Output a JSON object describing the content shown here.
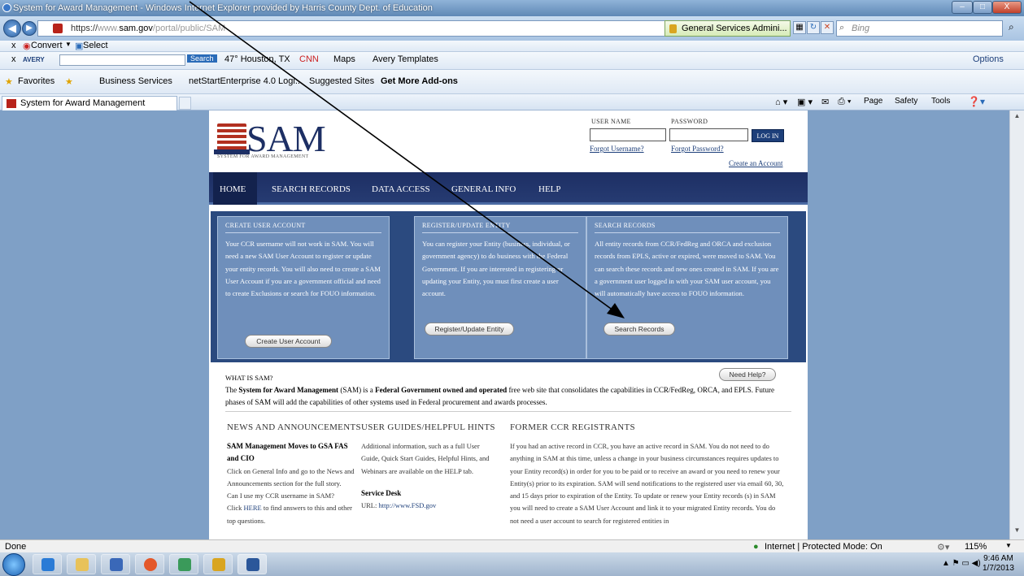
{
  "window": {
    "title": "System for Award Management - Windows Internet Explorer provided by Harris County Dept. of Education",
    "minimize": "–",
    "maximize": "□",
    "close": "X"
  },
  "addressbar": {
    "scheme": "https://",
    "host_prefix": "www.",
    "host": "sam.gov",
    "path": "/portal/public/SAM",
    "site_identity": "General Services Admini...",
    "search_placeholder": "Bing"
  },
  "toolbar1": {
    "convert": "Convert",
    "select": "Select"
  },
  "toolbar2": {
    "avery": "AVERY",
    "search": "Search",
    "weather": "47° Houston, TX",
    "cnn": "CNN",
    "maps": "Maps",
    "templates": "Avery Templates",
    "options": "Options"
  },
  "favorites": {
    "label": "Favorites",
    "items": [
      "Business Services",
      "netStartEnterprise 4.0 Logi...",
      "Suggested Sites",
      "Get More Add-ons"
    ]
  },
  "tab": {
    "label": "System for Award Management"
  },
  "commandbar": {
    "page": "Page",
    "safety": "Safety",
    "tools": "Tools"
  },
  "header": {
    "logo_text": "SAM",
    "logo_sub": "SYSTEM FOR AWARD MANAGEMENT",
    "username_label": "USER NAME",
    "password_label": "PASSWORD",
    "login": "LOG IN",
    "forgot_username": "Forgot Username?",
    "forgot_password": "Forgot Password?",
    "create_account": "Create an Account"
  },
  "nav": [
    "HOME",
    "SEARCH RECORDS",
    "DATA ACCESS",
    "GENERAL INFO",
    "HELP"
  ],
  "panels": [
    {
      "heading": "CREATE USER ACCOUNT",
      "text": "Your CCR username will not work in SAM. You will need a new SAM User Account to register or update your entity records. You will also need to create a SAM User Account if you are a government official and need to create Exclusions or search for FOUO information.",
      "button": "Create User Account"
    },
    {
      "heading": "REGISTER/UPDATE ENTITY",
      "text": "You can register your Entity (business, individual, or government agency) to do business with the Federal Government. If you are interested in registering or updating your Entity, you must first create a user account.",
      "button": "Register/Update Entity"
    },
    {
      "heading": "SEARCH RECORDS",
      "text": "All entity records from CCR/FedReg and ORCA and exclusion records from EPLS, active or expired, were moved to SAM. You can search these records and new ones created in SAM. If you are a government user logged in with your SAM user account, you will automatically have access to FOUO information.",
      "button": "Search Records"
    }
  ],
  "what": {
    "heading": "WHAT IS SAM?",
    "need_help": "Need Help?",
    "p1": "The ",
    "b1": "System for Award Management",
    "p2": " (SAM) is a ",
    "b2": "Federal Government owned and operated",
    "p3": " free web site that consolidates the capabilities in CCR/FedReg, ORCA, and EPLS. Future phases of SAM will add the capabilities of other systems used in Federal procurement and awards processes."
  },
  "columns": {
    "news": {
      "heading": "NEWS AND ANNOUNCEMENTS",
      "title": "SAM Management Moves to GSA FAS and CIO",
      "body": "Click on General Info and go to the News and Announcements section for the full story.",
      "q": "Can I use my CCR username in SAM?",
      "click": "Click ",
      "here": "HERE",
      "rest": " to find answers to this and other top questions."
    },
    "guides": {
      "heading": "USER GUIDES/HELPFUL HINTS",
      "body": "Additional information, such as a full User Guide, Quick Start Guides, Helpful Hints, and Webinars are available on the HELP tab.",
      "desk": "Service Desk",
      "url_label": "URL: ",
      "url": "http://www.FSD.gov"
    },
    "former": {
      "heading": "FORMER CCR REGISTRANTS",
      "body": "If you had an active record in CCR, you have an active record in SAM. You do not need to do anything in SAM at this time, unless a change in your business circumstances requires updates to your Entity record(s) in order for you to be paid or to receive an award or you need to renew your Entity(s) prior to its expiration. SAM will send notifications to the registered user via email 60, 30, and 15 days prior to expiration of the Entity. To update or renew your Entity records (s) in SAM you will need to create a SAM User Account and link it to your migrated Entity records. You do not need a user account to search for registered entities in"
    }
  },
  "statusbar": {
    "left": "Done",
    "zone": "Internet | Protected Mode: On",
    "zoom": "115%"
  },
  "taskbar": {
    "time": "9:46 AM",
    "date": "1/7/2013"
  },
  "colors": {
    "navy": "#1d2f64",
    "panel": "#6f8fbb",
    "annotation_arrow": "#000000"
  }
}
